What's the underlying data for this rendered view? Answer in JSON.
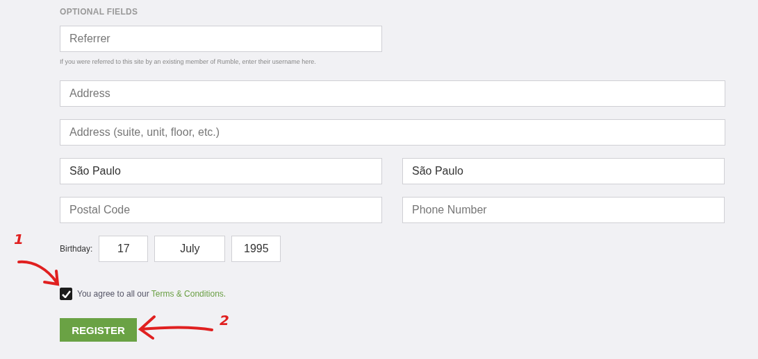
{
  "section_title": "OPTIONAL FIELDS",
  "referrer": {
    "placeholder": "Referrer",
    "hint": "If you were referred to this site by an existing member of Rumble, enter their username here."
  },
  "address_rows": [
    {
      "fields": [
        {
          "placeholder": "Address"
        }
      ]
    },
    {
      "fields": [
        {
          "placeholder": "Address (suite, unit, floor, etc.)"
        }
      ]
    },
    {
      "fields": [
        {
          "value": "São Paulo"
        },
        {
          "value": "São Paulo"
        }
      ]
    },
    {
      "fields": [
        {
          "placeholder": "Postal Code"
        },
        {
          "placeholder": "Phone Number"
        }
      ]
    }
  ],
  "birthday": {
    "label": "Birthday:",
    "day": "17",
    "month": "July",
    "year": "1995"
  },
  "terms": {
    "checked": true,
    "text": "You agree to all our",
    "link": "Terms & Conditions."
  },
  "register_button": "REGISTER",
  "annotations": [
    {
      "number": "1"
    },
    {
      "number": "2"
    }
  ]
}
